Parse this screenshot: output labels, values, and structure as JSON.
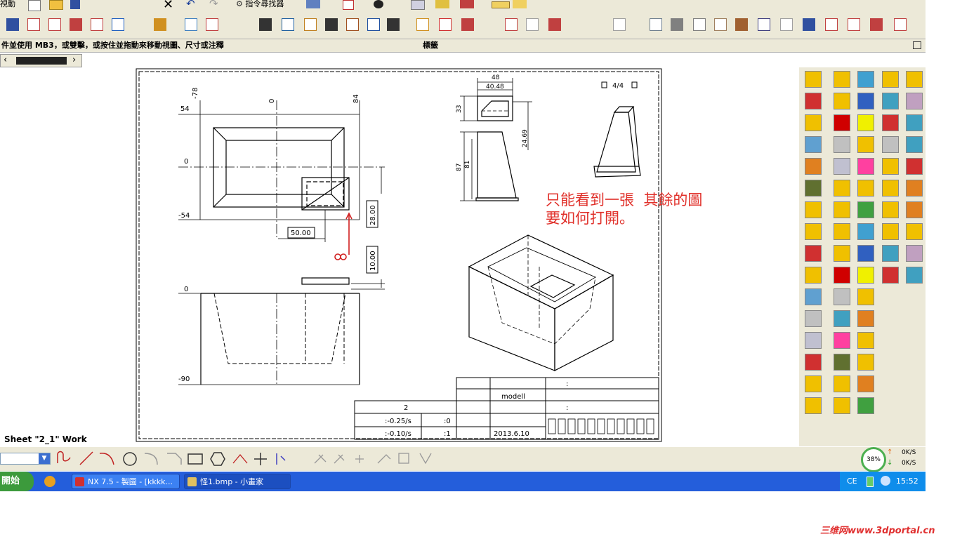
{
  "menu": {
    "first_item": "視動",
    "find_command": "指令尋找器"
  },
  "hint_bar": {
    "text": "件並使用 MB3，或雙擊，或按住並拖動來移動視圖、尺寸或注釋",
    "panel_label": "標籤"
  },
  "drawing": {
    "plan_labels": {
      "top_54": "54",
      "top_0": "0",
      "top_m54": "-54",
      "col_m78": "-78",
      "col_0": "0",
      "col_84": "84"
    },
    "dims": {
      "d50": "50.00",
      "d28": "28.00",
      "d10": "10.00"
    },
    "section_labels": {
      "z0": "0",
      "zm90": "-90"
    },
    "side_dims": {
      "w48": "48",
      "w4048": "40.48",
      "h33": "33",
      "h2469": "24.69",
      "h87": "87",
      "h81": "81"
    },
    "sheet_counter": "4/4",
    "title_block": {
      "scale_value": "2",
      "tol1": ":-0.25/s",
      "tol2": ":-0.10/s",
      "tol1b": ":0",
      "tol2b": ":1",
      "model": "modell",
      "date": "2013.6.10",
      "colon1": ":",
      "colon2": ":"
    }
  },
  "annotation": {
    "line1": "只能看到一張  其餘的圖",
    "line2": "要如何打開。"
  },
  "status": {
    "sheet_label": "Sheet \"2_1\" Work"
  },
  "taskbar": {
    "start": "開始",
    "tasks": [
      "NX 7.5 - 製圖 - [kkkk...",
      "怪1.bmp - 小畫家"
    ],
    "lang": "CE",
    "clock": "15:52"
  },
  "net_meter": {
    "percent": "38%",
    "up": "0K/S",
    "down": "0K/S"
  },
  "watermark": "三维网www.3dportal.cn",
  "colors": {
    "annotation_red": "#e0302a",
    "taskbar_blue": "#245edb",
    "start_green": "#3c9a3c"
  }
}
